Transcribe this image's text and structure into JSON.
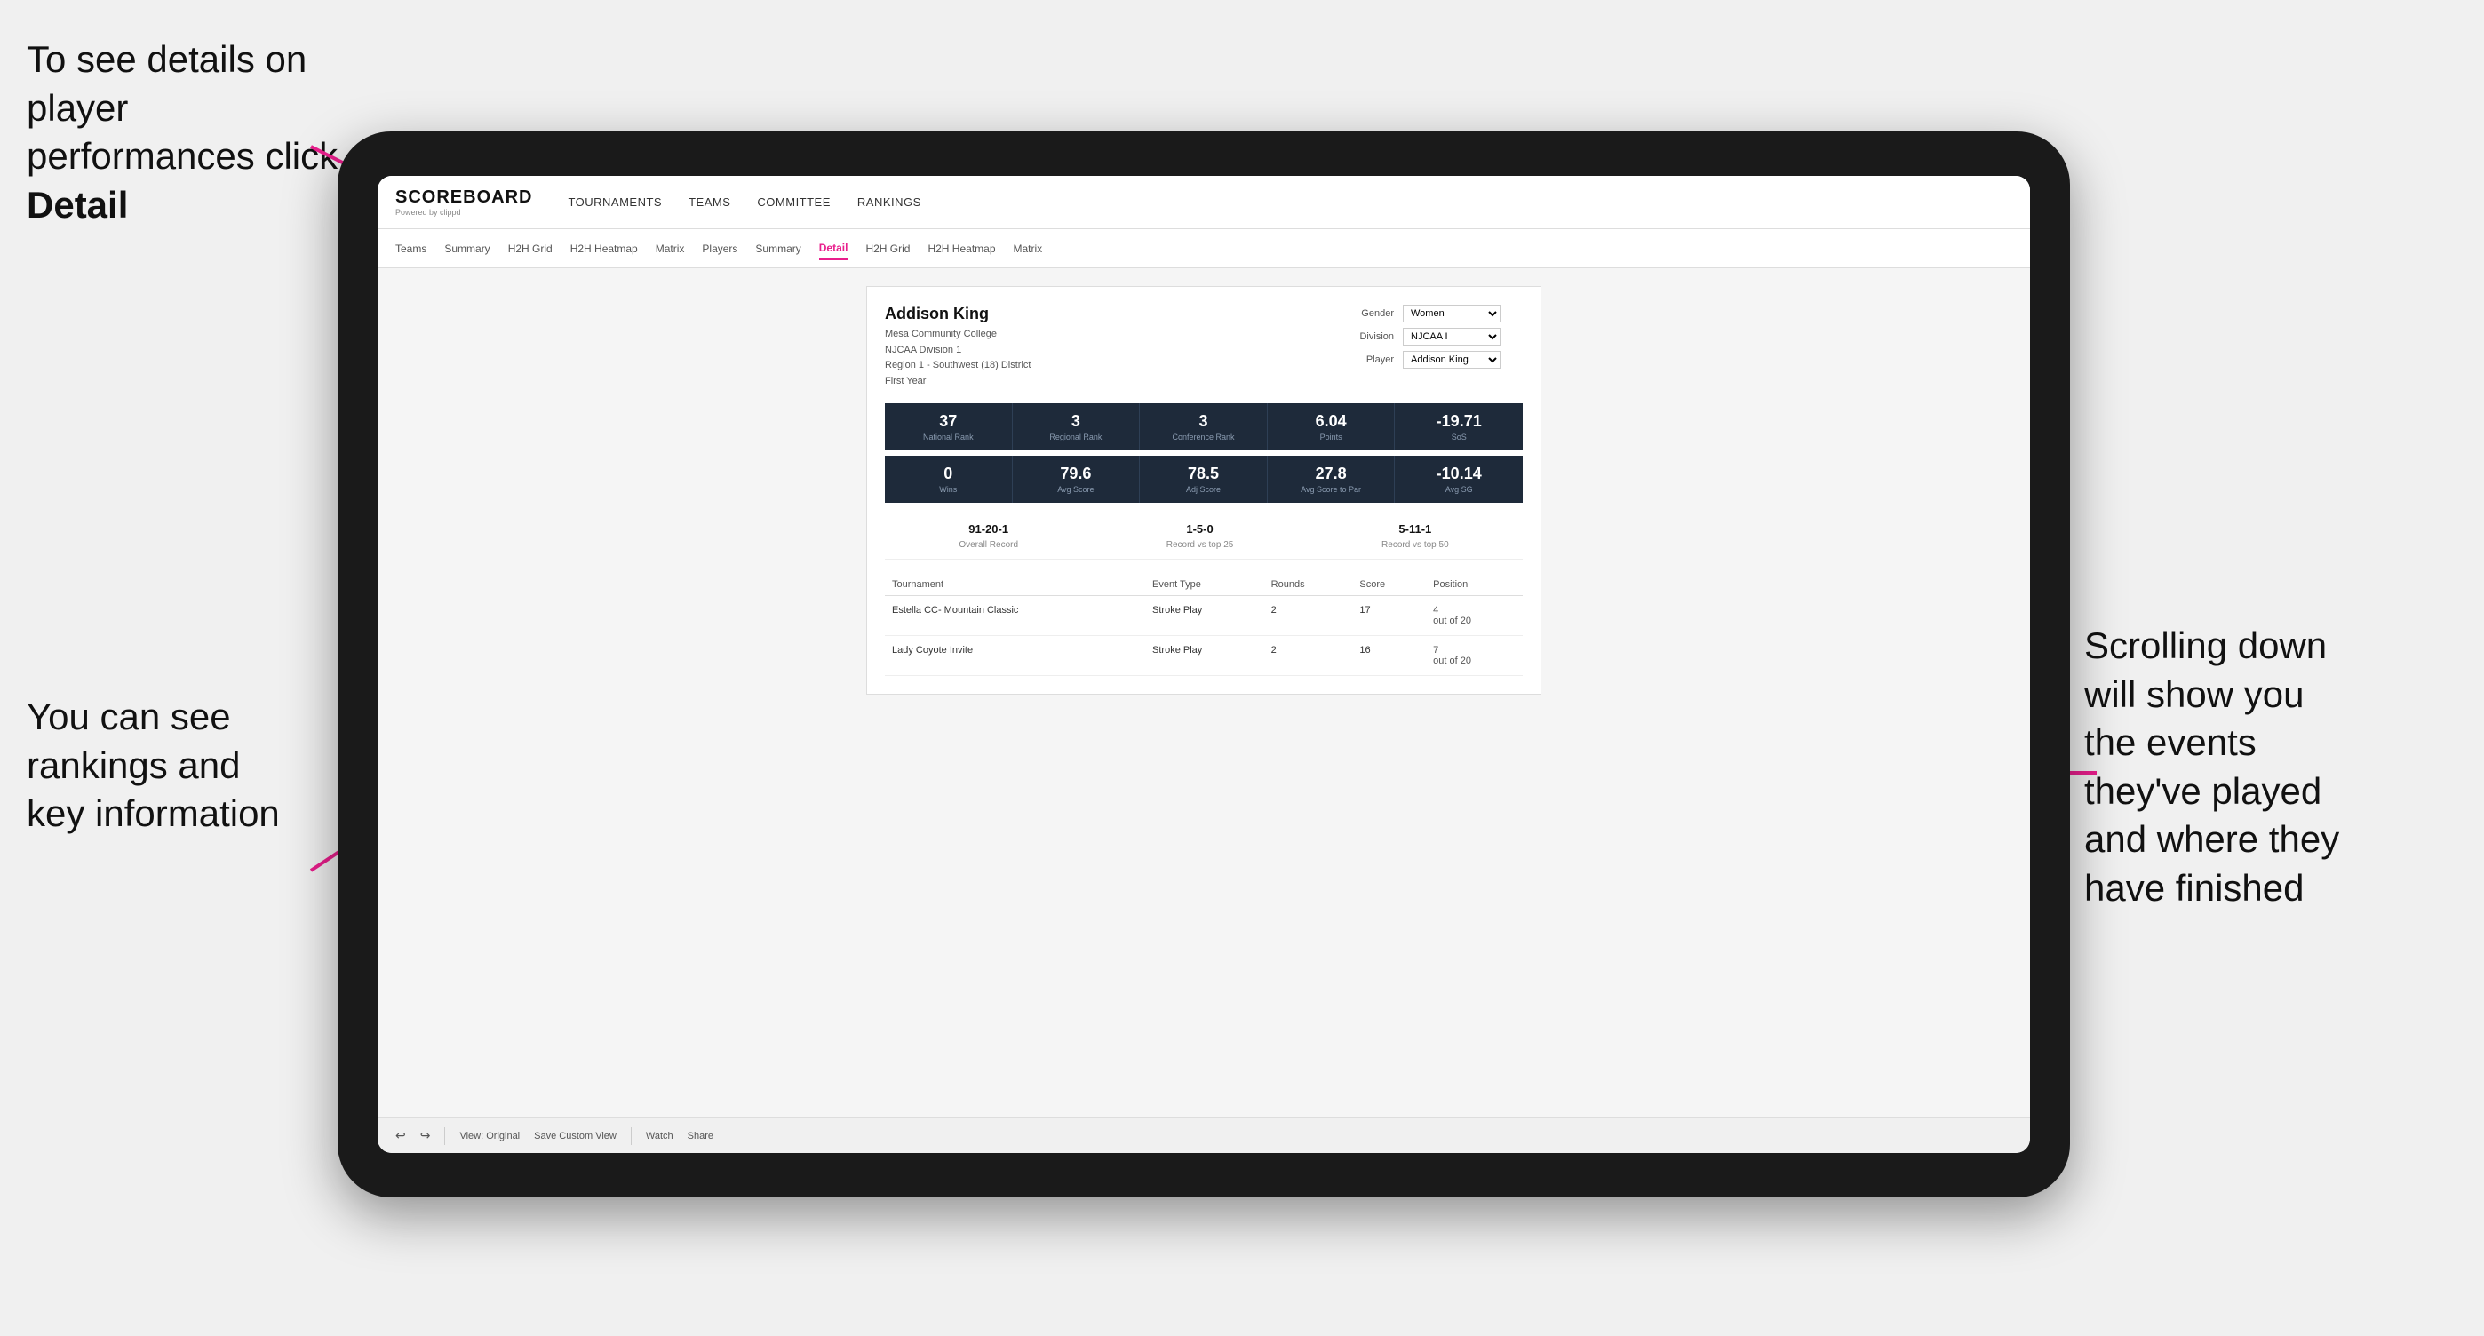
{
  "annotations": {
    "top_left": "To see details on player performances click ",
    "top_left_bold": "Detail",
    "bottom_left_line1": "You can see",
    "bottom_left_line2": "rankings and",
    "bottom_left_line3": "key information",
    "right_line1": "Scrolling down",
    "right_line2": "will show you",
    "right_line3": "the events",
    "right_line4": "they've played",
    "right_line5": "and where they",
    "right_line6": "have finished"
  },
  "nav": {
    "logo": "SCOREBOARD",
    "powered_by": "Powered by clippd",
    "items": [
      {
        "label": "TOURNAMENTS",
        "active": false
      },
      {
        "label": "TEAMS",
        "active": false
      },
      {
        "label": "COMMITTEE",
        "active": false
      },
      {
        "label": "RANKINGS",
        "active": false
      }
    ]
  },
  "subnav": {
    "items": [
      {
        "label": "Teams",
        "active": false
      },
      {
        "label": "Summary",
        "active": false
      },
      {
        "label": "H2H Grid",
        "active": false
      },
      {
        "label": "H2H Heatmap",
        "active": false
      },
      {
        "label": "Matrix",
        "active": false
      },
      {
        "label": "Players",
        "active": false
      },
      {
        "label": "Summary",
        "active": false
      },
      {
        "label": "Detail",
        "active": true
      },
      {
        "label": "H2H Grid",
        "active": false
      },
      {
        "label": "H2H Heatmap",
        "active": false
      },
      {
        "label": "Matrix",
        "active": false
      }
    ]
  },
  "player": {
    "name": "Addison King",
    "school": "Mesa Community College",
    "division": "NJCAA Division 1",
    "region": "Region 1 - Southwest (18) District",
    "year": "First Year"
  },
  "filters": {
    "gender_label": "Gender",
    "gender_value": "Women",
    "division_label": "Division",
    "division_value": "NJCAA I",
    "player_label": "Player",
    "player_value": "Addison King"
  },
  "stats_row1": [
    {
      "value": "37",
      "label": "National Rank"
    },
    {
      "value": "3",
      "label": "Regional Rank"
    },
    {
      "value": "3",
      "label": "Conference Rank"
    },
    {
      "value": "6.04",
      "label": "Points"
    },
    {
      "value": "-19.71",
      "label": "SoS"
    }
  ],
  "stats_row2": [
    {
      "value": "0",
      "label": "Wins"
    },
    {
      "value": "79.6",
      "label": "Avg Score"
    },
    {
      "value": "78.5",
      "label": "Adj Score"
    },
    {
      "value": "27.8",
      "label": "Avg Score to Par"
    },
    {
      "value": "-10.14",
      "label": "Avg SG"
    }
  ],
  "records": [
    {
      "value": "91-20-1",
      "label": "Overall Record"
    },
    {
      "value": "1-5-0",
      "label": "Record vs top 25"
    },
    {
      "value": "5-11-1",
      "label": "Record vs top 50"
    }
  ],
  "table_headers": [
    "Tournament",
    "",
    "Event Type",
    "Rounds",
    "Score",
    "Position"
  ],
  "tournaments": [
    {
      "name": "Estella CC- Mountain Classic",
      "event_type": "Stroke Play",
      "rounds": "2",
      "score": "17",
      "position": "4",
      "position_sub": "out of 20"
    },
    {
      "name": "Lady Coyote Invite",
      "event_type": "Stroke Play",
      "rounds": "2",
      "score": "16",
      "position": "7",
      "position_sub": "out of 20"
    }
  ],
  "toolbar": {
    "undo": "↩",
    "redo": "↪",
    "view_original": "View: Original",
    "save_custom": "Save Custom View",
    "watch": "Watch",
    "share": "Share"
  }
}
